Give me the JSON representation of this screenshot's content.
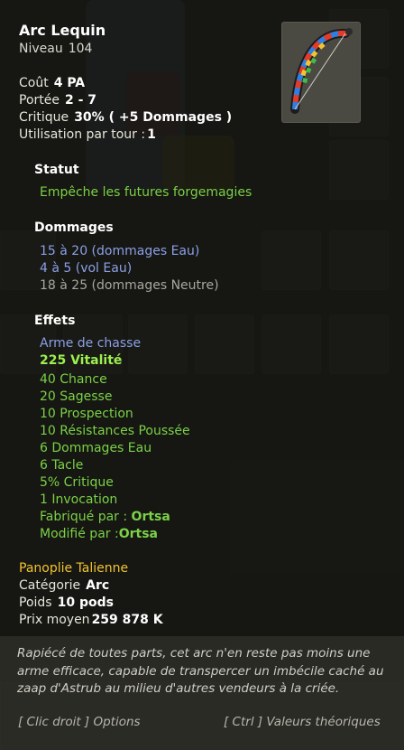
{
  "item": {
    "name": "Arc Lequin",
    "level_label": "Niveau",
    "level": "104",
    "icon": "bow-icon"
  },
  "stats": [
    {
      "label": "Coût",
      "value": "4 PA"
    },
    {
      "label": "Portée",
      "value": "2 - 7"
    },
    {
      "label": "Critique",
      "value": "30% ( +5 Dommages )"
    },
    {
      "label": "Utilisation par tour :",
      "value": "1"
    }
  ],
  "statut": {
    "title": "Statut",
    "text": "Empêche les futures forgemagies"
  },
  "dommages": {
    "title": "Dommages",
    "lines": [
      "15 à 20 (dommages Eau)",
      "4 à 5 (vol Eau)",
      "18 à 25 (dommages Neutre)"
    ]
  },
  "effets": {
    "title": "Effets",
    "type": "Arme de chasse",
    "vitality": "225 Vitalité",
    "lines": [
      "40 Chance",
      "20 Sagesse",
      "10 Prospection",
      "10 Résistances Poussée",
      "6 Dommages Eau",
      "6 Tacle",
      "5% Critique",
      "1 Invocation"
    ],
    "crafted_label": "Fabriqué par :",
    "crafted_by": "Ortsa",
    "modified_label": "Modifié par :",
    "modified_by": "Ortsa"
  },
  "info": {
    "set": "Panoplie Talienne",
    "category_label": "Catégorie",
    "category": "Arc",
    "weight_label": "Poids",
    "weight": "10 pods",
    "price_label": "Prix moyen",
    "price": "259 878 K"
  },
  "description": "Rapiécé de toutes parts, cet arc n'en reste pas moins une arme efficace, capable de transpercer un imbécile caché au zaap d'Astrub au milieu d'autres vendeurs à la criée.",
  "hints": {
    "options": "[ Clic droit ] Options",
    "theoretical": "[ Ctrl ] Valeurs théoriques"
  },
  "colors": {
    "effect_green": "#7bd147",
    "damage_water": "#8aa0e6",
    "damage_neutral": "#a8a8a0",
    "set_gold": "#f2c431"
  }
}
